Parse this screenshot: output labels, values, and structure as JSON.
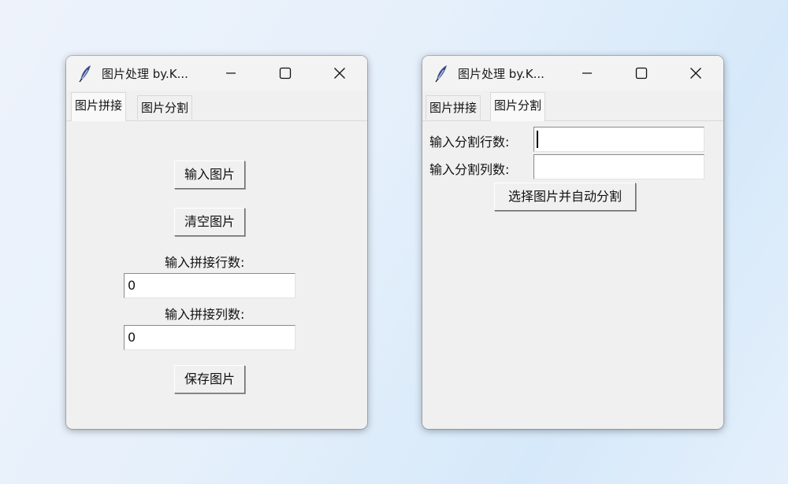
{
  "window_left": {
    "title": "图片处理 by.K...",
    "tabs": [
      {
        "label": "图片拼接",
        "active": true
      },
      {
        "label": "图片分割",
        "active": false
      }
    ],
    "input_image_button": "输入图片",
    "clear_image_button": "清空图片",
    "rows_label": "输入拼接行数:",
    "rows_value": "0",
    "cols_label": "输入拼接列数:",
    "cols_value": "0",
    "save_image_button": "保存图片"
  },
  "window_right": {
    "title": "图片处理 by.K...",
    "tabs": [
      {
        "label": "图片拼接",
        "active": false
      },
      {
        "label": "图片分割",
        "active": true
      }
    ],
    "rows_label": "输入分割行数:",
    "rows_value": "",
    "cols_label": "输入分割列数:",
    "cols_value": "",
    "auto_split_button": "选择图片并自动分割"
  },
  "icons": {
    "app": "feather-icon",
    "minimize": "minimize-icon",
    "maximize": "maximize-icon",
    "close": "close-icon"
  }
}
